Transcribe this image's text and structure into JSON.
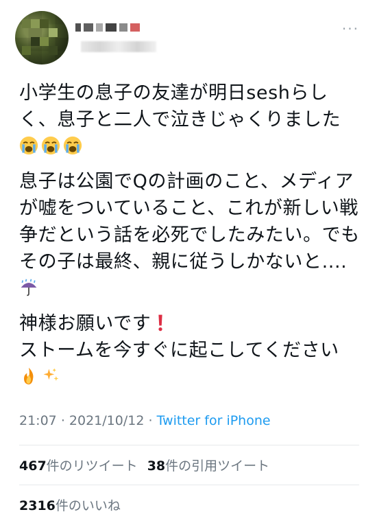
{
  "tweet": {
    "more_label": "···",
    "paragraphs": [
      "小学生の息子の友達が明日seshらしく、息子と二人で泣きじゃくりました",
      "息子は公園でQの計画のこと、メディアが嘘をついていること、これが新しい戦争だという話を必死でしたみたい。でもその子は最終、親に従うしかないと....",
      "神様お願いです",
      "ストームを今すぐに起こしてください"
    ],
    "icons": {
      "crying_face": "loudly-crying-face-emoji",
      "umbrella_rain": "umbrella-with-rain-emoji",
      "exclamation": "red-exclamation-emoji",
      "fire": "fire-emoji",
      "sparkles": "sparkles-emoji"
    },
    "time": "21:07",
    "separator": "·",
    "date": "2021/10/12",
    "source": "Twitter for iPhone"
  },
  "stats": {
    "retweets_count": "467",
    "retweets_label": "件のリツイート",
    "quotes_count": "38",
    "quotes_label": "件の引用ツイート",
    "likes_count": "2316",
    "likes_label": "件のいいね"
  },
  "colors": {
    "text": "#0f1419",
    "muted": "#6b7680",
    "link": "#1d9bf0",
    "divider": "#e6e9eb"
  }
}
